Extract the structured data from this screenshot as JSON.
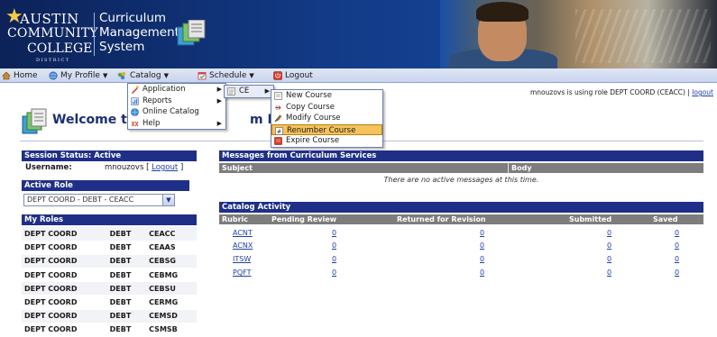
{
  "header": {
    "logo": {
      "line1": "AUSTIN",
      "line2": "COMMUNITY",
      "line3": "COLLEGE",
      "line4": "DISTRICT"
    },
    "app_title": [
      "Curriculum",
      "Management",
      "System"
    ]
  },
  "menubar": {
    "items": [
      {
        "label": "Home",
        "icon": "home-icon",
        "has_caret": false
      },
      {
        "label": "My Profile",
        "icon": "profile-globe-icon",
        "has_caret": true
      },
      {
        "label": "Catalog",
        "icon": "catalog-icon",
        "has_caret": true
      },
      {
        "label": "Schedule",
        "icon": "schedule-icon",
        "has_caret": true
      },
      {
        "label": "Logout",
        "icon": "logout-icon",
        "has_caret": false
      }
    ]
  },
  "session_line": {
    "text": "mnouzovs is using role DEPT COORD (CEACC) |",
    "logout": "logout"
  },
  "welcome": {
    "left": "Welcome to t",
    "right": "m Mana"
  },
  "catalog_menu": {
    "items": [
      {
        "label": "Application",
        "icon": "application-icon",
        "submenu": true
      },
      {
        "label": "Reports",
        "icon": "reports-icon",
        "submenu": true
      },
      {
        "label": "Online Catalog",
        "icon": "online-catalog-icon",
        "submenu": false
      },
      {
        "label": "Help",
        "icon": "help-icon",
        "submenu": true
      }
    ]
  },
  "application_menu": {
    "items": [
      {
        "label": "CE",
        "icon": "ce-icon",
        "submenu": true
      }
    ]
  },
  "ce_menu": {
    "items": [
      {
        "label": "New Course",
        "icon": "new-course-icon",
        "active": false
      },
      {
        "label": "Copy Course",
        "icon": "copy-course-icon",
        "active": false
      },
      {
        "label": "Modify Course",
        "icon": "modify-course-icon",
        "active": false
      },
      {
        "label": "Renumber Course",
        "icon": "renumber-course-icon",
        "active": true
      },
      {
        "label": "Expire Course",
        "icon": "expire-course-icon",
        "active": false
      }
    ]
  },
  "session_status": {
    "header": "Session Status: Active",
    "username_label": "Username:",
    "username": "mnouzovs",
    "logout": "Logout",
    "bracket_open": "[",
    "bracket_close": "]"
  },
  "active_role": {
    "header": "Active Role",
    "selected": "DEPT COORD - DEBT - CEACC"
  },
  "my_roles": {
    "header": "My Roles",
    "rows": [
      [
        "DEPT COORD",
        "DEBT",
        "CEACC"
      ],
      [
        "DEPT COORD",
        "DEBT",
        "CEAAS"
      ],
      [
        "DEPT COORD",
        "DEBT",
        "CEBSG"
      ],
      [
        "DEPT COORD",
        "DEBT",
        "CEBMG"
      ],
      [
        "DEPT COORD",
        "DEBT",
        "CEBSU"
      ],
      [
        "DEPT COORD",
        "DEBT",
        "CERMG"
      ],
      [
        "DEPT COORD",
        "DEBT",
        "CEMSD"
      ],
      [
        "DEPT COORD",
        "DEBT",
        "CSMSB"
      ]
    ]
  },
  "messages": {
    "header": "Messages from Curriculum Services",
    "columns": [
      "Subject",
      "Body"
    ],
    "empty": "There are no active messages at this time."
  },
  "catalog_activity": {
    "header": "Catalog Activity",
    "columns": [
      "Rubric",
      "Pending Review",
      "Returned for Revision",
      "Submitted",
      "Saved"
    ],
    "rows": [
      [
        "ACNT",
        "0",
        "0",
        "0",
        "0"
      ],
      [
        "ACNX",
        "0",
        "0",
        "0",
        "0"
      ],
      [
        "ITSW",
        "0",
        "0",
        "0",
        "0"
      ],
      [
        "PQFT",
        "0",
        "0",
        "0",
        "0"
      ]
    ]
  },
  "colors": {
    "header_blue": "#1f2f88",
    "menu_highlight": "#f6c35a",
    "link": "#1f3fa8",
    "table_header_gray": "#7d7d7d"
  }
}
